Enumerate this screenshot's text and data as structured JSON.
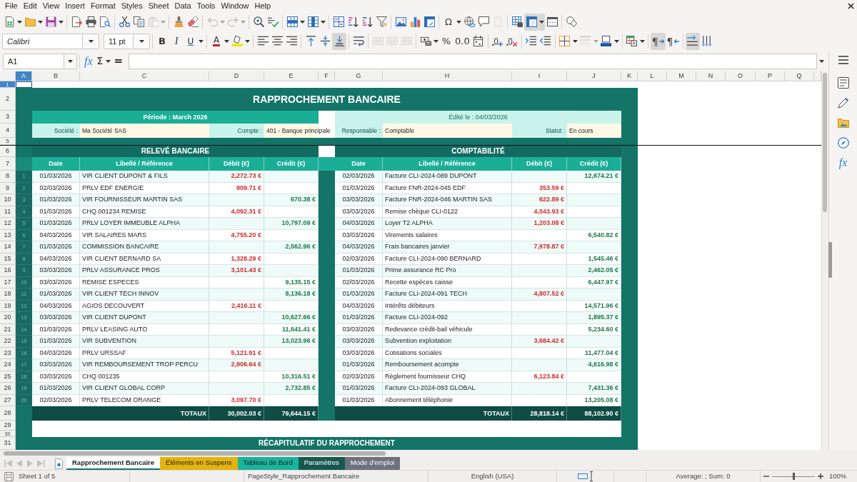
{
  "menu_bar": [
    "File",
    "Edit",
    "View",
    "Insert",
    "Format",
    "Styles",
    "Sheet",
    "Data",
    "Tools",
    "Window",
    "Help"
  ],
  "standard_toolbar": [
    {
      "kind": "split",
      "disabled": false,
      "pressed": false
    },
    {
      "kind": "split",
      "disabled": false,
      "pressed": false
    },
    {
      "kind": "split",
      "disabled": false,
      "pressed": false
    },
    {
      "kind": "button",
      "disabled": false,
      "pressed": false
    },
    {
      "kind": "button",
      "disabled": false,
      "pressed": false
    },
    {
      "kind": "button",
      "disabled": false,
      "pressed": false
    },
    {
      "kind": "button",
      "disabled": false,
      "pressed": false
    },
    {
      "kind": "button",
      "disabled": false,
      "pressed": false
    },
    {
      "kind": "split",
      "disabled": true,
      "pressed": false
    },
    {
      "kind": "button",
      "disabled": false,
      "pressed": false
    },
    {
      "kind": "button",
      "disabled": false,
      "pressed": false
    },
    {
      "kind": "split",
      "disabled": true,
      "pressed": false
    },
    {
      "kind": "split",
      "disabled": true,
      "pressed": false
    },
    {
      "kind": "button",
      "disabled": false,
      "pressed": false
    },
    {
      "kind": "button",
      "disabled": false,
      "pressed": false
    },
    {
      "kind": "split",
      "disabled": false,
      "pressed": false
    },
    {
      "kind": "split",
      "disabled": false,
      "pressed": false
    },
    {
      "kind": "button",
      "disabled": false,
      "pressed": false
    },
    {
      "kind": "button",
      "disabled": false,
      "pressed": false
    },
    {
      "kind": "button",
      "disabled": false,
      "pressed": false
    },
    {
      "kind": "button",
      "disabled": false,
      "pressed": false
    },
    {
      "kind": "button",
      "disabled": false,
      "pressed": false
    },
    {
      "kind": "button",
      "disabled": false,
      "pressed": false
    },
    {
      "kind": "button",
      "disabled": false,
      "pressed": false
    },
    {
      "kind": "split",
      "disabled": false,
      "pressed": false,
      "label": "Ω"
    },
    {
      "kind": "button",
      "disabled": false,
      "pressed": false
    },
    {
      "kind": "button",
      "disabled": false,
      "pressed": false
    },
    {
      "kind": "button",
      "disabled": true,
      "pressed": false
    },
    {
      "kind": "button",
      "disabled": false,
      "pressed": false
    },
    {
      "kind": "split",
      "disabled": false,
      "pressed": true
    },
    {
      "kind": "button",
      "disabled": false,
      "pressed": false
    },
    {
      "kind": "button",
      "disabled": false,
      "pressed": false
    }
  ],
  "formatting_toolbar": {
    "font_name": "Calibri",
    "font_size": "11 pt",
    "buttons": [
      {
        "kind": "button",
        "disabled": false,
        "pressed": false,
        "label": "B"
      },
      {
        "kind": "button",
        "disabled": false,
        "pressed": false,
        "label": "I"
      },
      {
        "kind": "split",
        "disabled": false,
        "pressed": false,
        "label": "U"
      },
      {
        "kind": "split",
        "disabled": false,
        "pressed": false,
        "label": "A"
      },
      {
        "kind": "split",
        "disabled": false,
        "pressed": false
      },
      {
        "kind": "button",
        "disabled": false,
        "pressed": false
      },
      {
        "kind": "button",
        "disabled": false,
        "pressed": false
      },
      {
        "kind": "button",
        "disabled": false,
        "pressed": false
      },
      {
        "kind": "button",
        "disabled": false,
        "pressed": false
      },
      {
        "kind": "button",
        "disabled": false,
        "pressed": false
      },
      {
        "kind": "button",
        "disabled": false,
        "pressed": true
      },
      {
        "kind": "button",
        "disabled": false,
        "pressed": false
      },
      {
        "kind": "button",
        "disabled": true,
        "pressed": false
      },
      {
        "kind": "button",
        "disabled": true,
        "pressed": false
      },
      {
        "kind": "button",
        "disabled": true,
        "pressed": false
      },
      {
        "kind": "split",
        "disabled": false,
        "pressed": false
      },
      {
        "kind": "button",
        "disabled": false,
        "pressed": false,
        "label": "%"
      },
      {
        "kind": "button",
        "disabled": false,
        "pressed": false,
        "label": "0.0"
      },
      {
        "kind": "button",
        "disabled": false,
        "pressed": false
      },
      {
        "kind": "button",
        "disabled": false,
        "pressed": false
      },
      {
        "kind": "button",
        "disabled": false,
        "pressed": false
      },
      {
        "kind": "button",
        "disabled": false,
        "pressed": false
      },
      {
        "kind": "button",
        "disabled": false,
        "pressed": false
      },
      {
        "kind": "split",
        "disabled": false,
        "pressed": false
      },
      {
        "kind": "split",
        "disabled": true,
        "pressed": false
      },
      {
        "kind": "split",
        "disabled": false,
        "pressed": false
      },
      {
        "kind": "split",
        "disabled": false,
        "pressed": false
      },
      {
        "kind": "button",
        "disabled": false,
        "pressed": true,
        "label": "¶"
      },
      {
        "kind": "button",
        "disabled": false,
        "pressed": false,
        "label": "¶"
      },
      {
        "kind": "button",
        "disabled": false,
        "pressed": true
      },
      {
        "kind": "button",
        "disabled": false,
        "pressed": false
      }
    ]
  },
  "formula_bar": {
    "cell_reference": "A1",
    "buttons": [
      {
        "kind": "button",
        "label": "fx"
      },
      {
        "kind": "split",
        "label": "Σ"
      },
      {
        "kind": "button",
        "label": "="
      }
    ]
  },
  "sidebar": [
    {
      "selected": false
    },
    {
      "selected": false
    },
    {
      "selected": false
    },
    {
      "selected": false
    },
    {
      "selected": false,
      "label": "fx"
    }
  ],
  "columns": [
    {
      "label": "A",
      "selected": true
    },
    {
      "label": "B",
      "selected": false
    },
    {
      "label": "C",
      "selected": false
    },
    {
      "label": "D",
      "selected": false
    },
    {
      "label": "E",
      "selected": false
    },
    {
      "label": "F",
      "selected": false
    },
    {
      "label": "G",
      "selected": false
    },
    {
      "label": "H",
      "selected": false
    },
    {
      "label": "I",
      "selected": false
    },
    {
      "label": "J",
      "selected": false
    },
    {
      "label": "K",
      "selected": false
    },
    {
      "label": "L",
      "selected": false
    },
    {
      "label": "M",
      "selected": false
    },
    {
      "label": "N",
      "selected": false
    },
    {
      "label": "O",
      "selected": false
    },
    {
      "label": "P",
      "selected": false
    },
    {
      "label": "Q",
      "selected": false
    }
  ],
  "row_headers": [
    {
      "label": "1",
      "selected": true
    },
    {
      "label": "2",
      "selected": false
    },
    {
      "label": "3",
      "selected": false
    },
    {
      "label": "4",
      "selected": false
    },
    {
      "label": "5",
      "selected": false
    },
    {
      "label": "6",
      "selected": false
    },
    {
      "label": "7",
      "selected": false
    },
    {
      "label": "8",
      "selected": false
    },
    {
      "label": "9",
      "selected": false
    },
    {
      "label": "10",
      "selected": false
    },
    {
      "label": "11",
      "selected": false
    },
    {
      "label": "12",
      "selected": false
    },
    {
      "label": "13",
      "selected": false
    },
    {
      "label": "14",
      "selected": false
    },
    {
      "label": "15",
      "selected": false
    },
    {
      "label": "16",
      "selected": false
    },
    {
      "label": "17",
      "selected": false
    },
    {
      "label": "18",
      "selected": false
    },
    {
      "label": "19",
      "selected": false
    },
    {
      "label": "20",
      "selected": false
    },
    {
      "label": "21",
      "selected": false
    },
    {
      "label": "22",
      "selected": false
    },
    {
      "label": "23",
      "selected": false
    },
    {
      "label": "24",
      "selected": false
    },
    {
      "label": "25",
      "selected": false
    },
    {
      "label": "26",
      "selected": false
    },
    {
      "label": "27",
      "selected": false
    },
    {
      "label": "28",
      "selected": false
    },
    {
      "label": "29",
      "selected": false
    },
    {
      "label": "30",
      "selected": false
    },
    {
      "label": "31",
      "selected": false
    }
  ],
  "report": {
    "title": "RAPPROCHEMENT BANCAIRE",
    "period": "Période : March 2026",
    "edited": "Édité le : 04/03/2026",
    "fields": [
      {
        "label": "Société :",
        "value": "Ma Société SAS"
      },
      {
        "label": "Compte :",
        "value": "401 - Banque principale"
      },
      {
        "label": "Responsable :",
        "value": "Comptable"
      },
      {
        "label": "Statut :",
        "value": "En cours"
      }
    ],
    "sections": [
      {
        "title": "RELEVÉ BANCAIRE",
        "columns": [
          "Date",
          "Libellé / Référence",
          "Débit (€)",
          "Crédit (€)"
        ],
        "rows": [
          {
            "number": "1",
            "date": "01/03/2026",
            "description": "VIR CLIENT DUPONT & FILS",
            "debit": "2,272.73 €"
          },
          {
            "number": "2",
            "date": "02/03/2026",
            "description": "PRLV EDF ENERGIE",
            "debit": "909.71 €"
          },
          {
            "number": "3",
            "date": "01/03/2026",
            "description": "VIR FOURNISSEUR MARTIN SAS",
            "credit": "670.38 €"
          },
          {
            "number": "4",
            "date": "01/03/2026",
            "description": "CHQ 001234 REMISE",
            "debit": "4,092.31 €"
          },
          {
            "number": "5",
            "date": "01/03/2026",
            "description": "PRLV LOYER IMMEUBLE ALPHA",
            "credit": "10,797.09 €"
          },
          {
            "number": "6",
            "date": "04/03/2026",
            "description": "VIR SALAIRES MARS",
            "debit": "4,755.20 €"
          },
          {
            "number": "7",
            "date": "01/03/2026",
            "description": "COMMISSION BANCAIRE",
            "credit": "2,562.96 €"
          },
          {
            "number": "8",
            "date": "04/03/2026",
            "description": "VIR CLIENT BERNARD SA",
            "debit": "1,328.29 €"
          },
          {
            "number": "9",
            "date": "03/03/2026",
            "description": "PRLV ASSURANCE PROS",
            "debit": "3,101.43 €"
          },
          {
            "number": "10",
            "date": "03/03/2026",
            "description": "REMISE ESPECES",
            "credit": "9,135.15 €"
          },
          {
            "number": "11",
            "date": "01/03/2026",
            "description": "VIR CLIENT TECH INNOV",
            "credit": "8,136.18 €"
          },
          {
            "number": "12",
            "date": "04/03/2026",
            "description": "AGIOS DECOUVERT",
            "debit": "2,416.11 €"
          },
          {
            "number": "13",
            "date": "03/03/2026",
            "description": "VIR CLIENT DUPONT",
            "credit": "10,627.66 €"
          },
          {
            "number": "14",
            "date": "01/03/2026",
            "description": "PRLV LEASING AUTO",
            "credit": "11,641.41 €"
          },
          {
            "number": "15",
            "date": "01/03/2026",
            "description": "VIR SUBVENTION",
            "credit": "13,023.96 €"
          },
          {
            "number": "16",
            "date": "04/03/2026",
            "description": "PRLV URSSAF",
            "debit": "5,121.91 €"
          },
          {
            "number": "17",
            "date": "03/03/2026",
            "description": "VIR REMBOURSEMENT TROP PERCU",
            "debit": "2,906.64 €"
          },
          {
            "number": "18",
            "date": "03/03/2026",
            "description": "CHQ 001235",
            "credit": "10,316.51 €"
          },
          {
            "number": "19",
            "date": "01/03/2026",
            "description": "VIR CLIENT GLOBAL CORP",
            "credit": "2,732.85 €"
          },
          {
            "number": "20",
            "date": "02/03/2026",
            "description": "PRLV TELECOM ORANGE",
            "debit": "3,097.70 €"
          }
        ],
        "totals": {
          "label": "TOTAUX",
          "debit": "30,002.03 €",
          "credit": "79,644.15 €"
        }
      },
      {
        "title": "COMPTABILITÉ",
        "columns": [
          "Date",
          "Libellé / Référence",
          "Débit (€)",
          "Crédit (€)"
        ],
        "rows": [
          {
            "date": "02/03/2026",
            "description": "Facture CLI-2024-089 DUPONT",
            "credit": "12,674.21 €"
          },
          {
            "date": "01/03/2026",
            "description": "Facture FNR-2024-045 EDF",
            "debit": "353.59 €"
          },
          {
            "date": "03/03/2026",
            "description": "Facture FNR-2024-046 MARTIN SAS",
            "debit": "622.89 €"
          },
          {
            "date": "03/03/2026",
            "description": "Remise chèque CLI-0122",
            "debit": "4,043.93 €"
          },
          {
            "date": "04/03/2026",
            "description": "Loyer T2 ALPHA",
            "debit": "1,203.08 €"
          },
          {
            "date": "03/03/2026",
            "description": "Virements salaires",
            "credit": "6,540.82 €"
          },
          {
            "date": "04/03/2026",
            "description": "Frais bancaires janvier",
            "debit": "7,978.87 €"
          },
          {
            "date": "02/03/2026",
            "description": "Facture CLI-2024-090 BERNARD",
            "credit": "1,545.46 €"
          },
          {
            "date": "01/03/2026",
            "description": "Prime assurance RC Pro",
            "credit": "2,462.05 €"
          },
          {
            "date": "02/03/2026",
            "description": "Recette espèces caisse",
            "credit": "6,447.97 €"
          },
          {
            "date": "01/03/2026",
            "description": "Facture CLI-2024-091 TECH",
            "debit": "4,807.52 €"
          },
          {
            "date": "04/03/2026",
            "description": "Intérêts débiteurs",
            "credit": "14,571.96 €"
          },
          {
            "date": "01/03/2026",
            "description": "Facture CLI-2024-092",
            "credit": "1,895.37 €"
          },
          {
            "date": "03/03/2026",
            "description": "Redevance crédit-bail véhicule",
            "credit": "5,234.60 €"
          },
          {
            "date": "03/03/2026",
            "description": "Subvention exploitation",
            "debit": "3,684.42 €"
          },
          {
            "date": "03/03/2026",
            "description": "Cotisations sociales",
            "credit": "11,477.04 €"
          },
          {
            "date": "01/03/2026",
            "description": "Remboursement acompte",
            "credit": "4,616.98 €"
          },
          {
            "date": "02/03/2026",
            "description": "Règlement fournisseur CHQ",
            "debit": "6,123.84 €"
          },
          {
            "date": "01/03/2026",
            "description": "Facture CLI-2024-093 GLOBAL",
            "credit": "7,431.36 €"
          },
          {
            "date": "01/03/2026",
            "description": "Abonnement téléphonie",
            "credit": "13,205.08 €"
          }
        ],
        "totals": {
          "label": "TOTAUX",
          "debit": "28,818.14 €",
          "credit": "88,102.90 €"
        }
      }
    ],
    "summary_title": "RÉCAPITULATIF DU RAPPROCHEMENT"
  },
  "sheet_navigation": [
    {
      "disabled": true
    },
    {
      "disabled": true
    },
    {
      "disabled": true
    },
    {
      "disabled": true
    }
  ],
  "sheet_tabs": [
    {
      "label": "Rapprochement Bancaire",
      "selected": true,
      "color": "#13766a"
    },
    {
      "label": "Éléments en Suspens",
      "selected": false,
      "color": "#e4b30e"
    },
    {
      "label": "Tableau de Bord",
      "selected": false,
      "color": "#1ab39b"
    },
    {
      "label": "Paramètres",
      "selected": false,
      "color": "#17574f"
    },
    {
      "label": "Mode d'emploi",
      "selected": false,
      "color": "#6c737c"
    }
  ],
  "status_bar": {
    "sheet": "Sheet 1 of 5",
    "page_style": "PageStyle_Rapprochement Bancaire",
    "language": "English (USA)",
    "selection_summary": "Average: ; Sum: 0",
    "zoom": {
      "level": 0.5,
      "reading": "100%"
    }
  }
}
